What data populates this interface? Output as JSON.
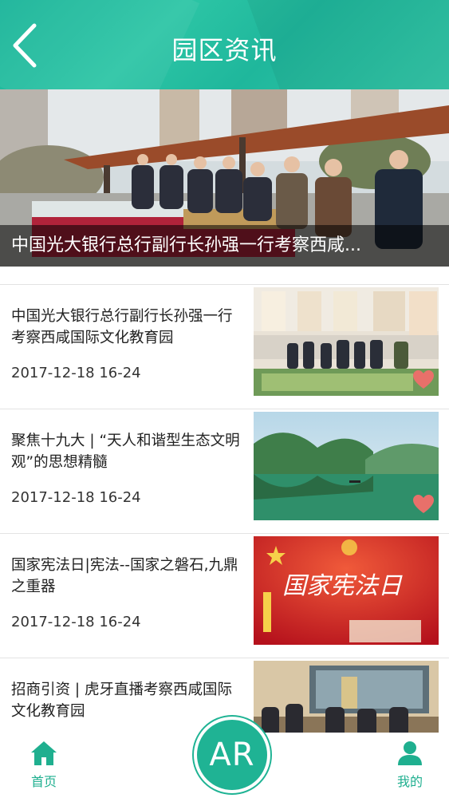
{
  "header": {
    "title": "园区资讯",
    "back_icon": "chevron-left-icon"
  },
  "banner": {
    "caption": "中国光大银行总行副行长孙强一行考察西咸..."
  },
  "news": [
    {
      "title": "中国光大银行总行副行长孙强一行考察西咸国际文化教育园",
      "date": "2017-12-18 16-24"
    },
    {
      "title": "聚焦十九大 | “天人和谐型生态文明观”的思想精髓",
      "date": "2017-12-18 16-24"
    },
    {
      "title": "国家宪法日|宪法--国家之磐石,九鼎之重器",
      "date": "2017-12-18 16-24"
    },
    {
      "title": "招商引资 | 虎牙直播考察西咸国际文化教育园",
      "date": ""
    }
  ],
  "thumb_text": {
    "constitution_day": "国家宪法日"
  },
  "bottom_nav": {
    "home_label": "首页",
    "ar_label": "AR",
    "me_label": "我的"
  },
  "colors": {
    "accent": "#1fb394",
    "heart": "#e8706a"
  }
}
